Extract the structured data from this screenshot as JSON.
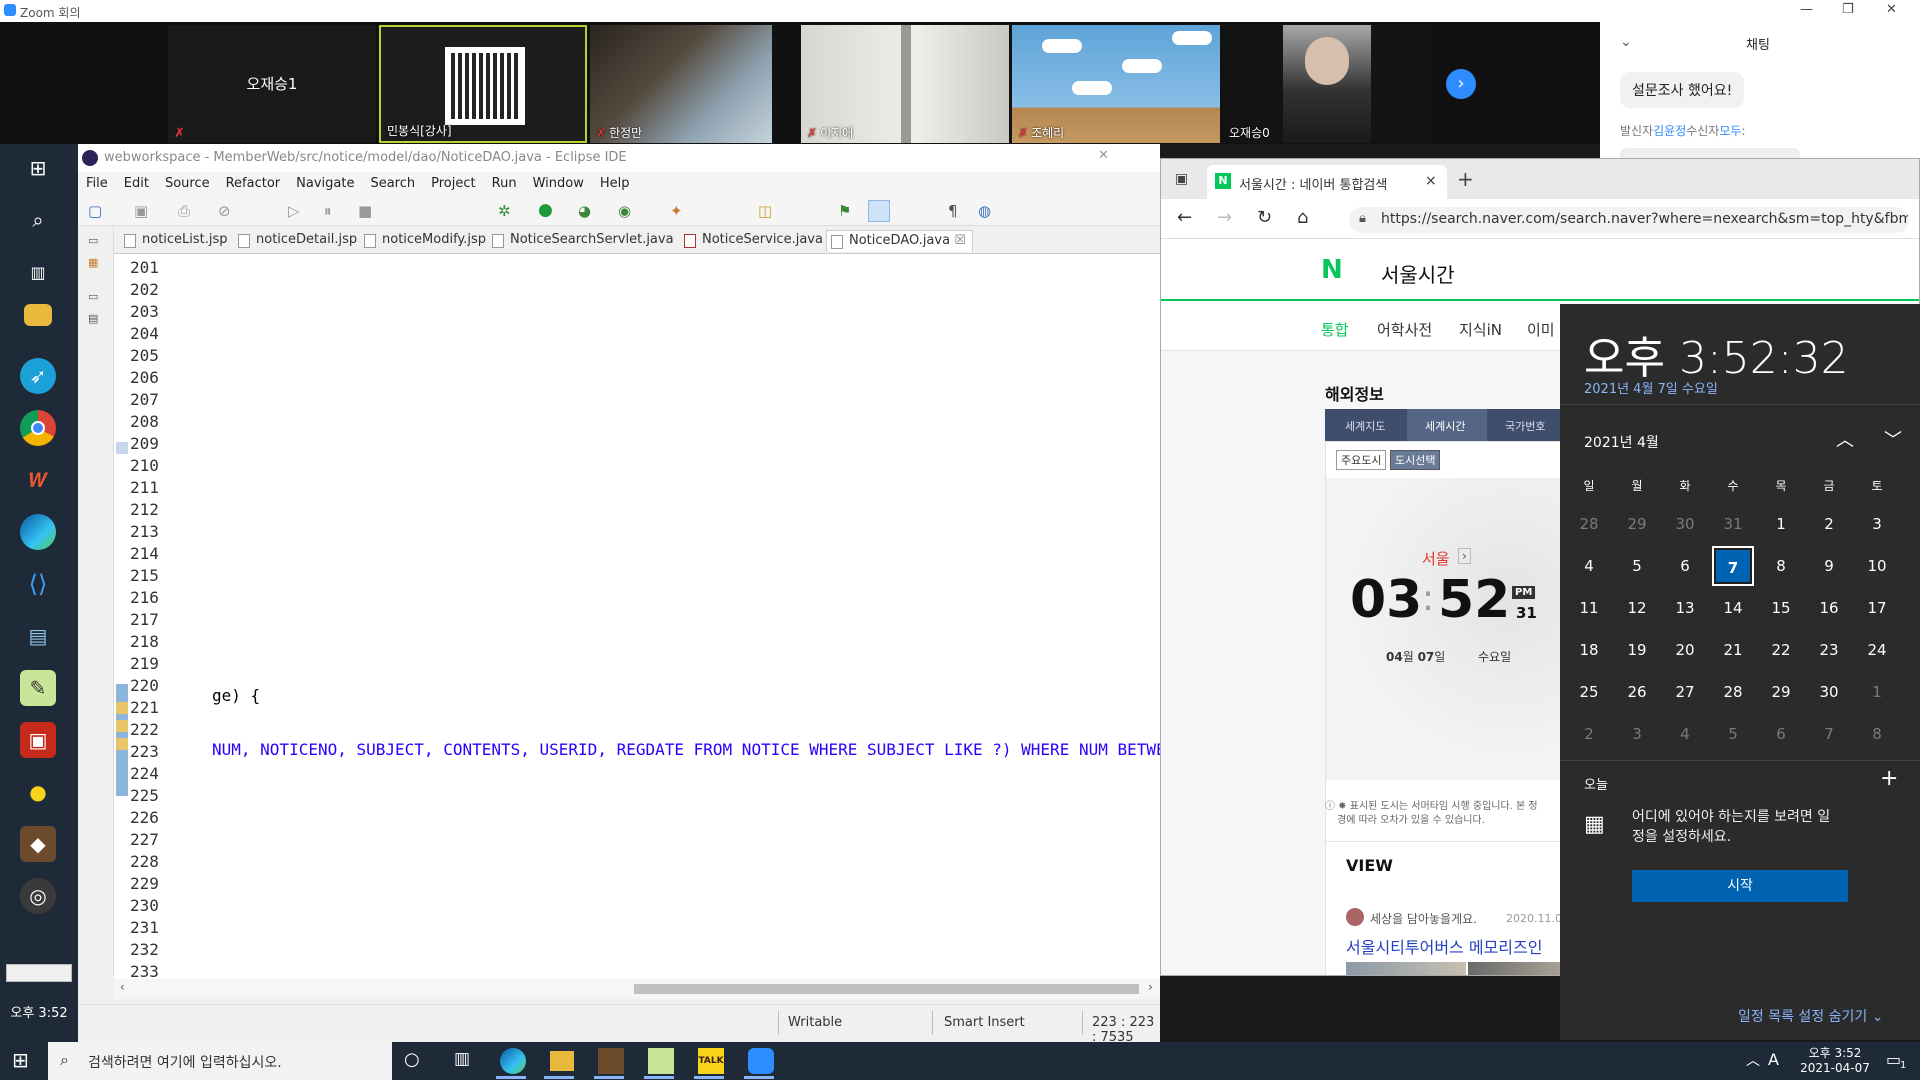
{
  "zoom": {
    "window_title": "Zoom 회의",
    "participants": [
      {
        "name": "오재승1"
      },
      {
        "name": "민봉식[강사]"
      },
      {
        "name": "한정만"
      },
      {
        "name": "이지애"
      },
      {
        "name": "조혜리"
      },
      {
        "name": "오재승0"
      }
    ],
    "chat": {
      "title": "채팅",
      "message": "설문조사 했어요!",
      "meta_prefix": "발신자",
      "sender": "김윤정",
      "meta_mid": "수신자",
      "recipient": "모두",
      "meta_suffix": ":"
    }
  },
  "left_taskbar": {
    "clock": "오후 3:52",
    "icons": [
      "windows-icon",
      "search-icon",
      "task-view-icon",
      "file-explorer-icon",
      "bird-app-icon",
      "chrome-icon",
      "app-icon",
      "edge-icon",
      "vscode-icon",
      "remote-desktop-icon",
      "notes-icon",
      "presentation-icon",
      "messenger-icon",
      "game-icon",
      "obs-icon"
    ]
  },
  "eclipse": {
    "title": "webworkspace - MemberWeb/src/notice/model/dao/NoticeDAO.java - Eclipse IDE",
    "menu": [
      "File",
      "Edit",
      "Source",
      "Refactor",
      "Navigate",
      "Search",
      "Project",
      "Run",
      "Window",
      "Help"
    ],
    "tabs": [
      {
        "label": "noticeList.jsp"
      },
      {
        "label": "noticeDetail.jsp"
      },
      {
        "label": "noticeModify.jsp"
      },
      {
        "label": "NoticeSearchServlet.java"
      },
      {
        "label": "NoticeService.java"
      },
      {
        "label": "NoticeDAO.java"
      }
    ],
    "tab_close": "☒",
    "line_numbers": [
      "201",
      "202",
      "203",
      "204",
      "205",
      "206",
      "207",
      "208",
      "209",
      "210",
      "211",
      "212",
      "213",
      "214",
      "215",
      "216",
      "217",
      "218",
      "219",
      "220",
      "221",
      "222",
      "223",
      "224",
      "225",
      "226",
      "227",
      "228",
      "229",
      "230",
      "231",
      "232",
      "233"
    ],
    "code_line_220": "ge) {",
    "code_line_223": "NUM, NOTICENO, SUBJECT, CONTENTS, USERID, REGDATE FROM NOTICE WHERE SUBJECT LIKE ?) WHERE NUM BETWEEN ? AN",
    "status": {
      "writable": "Writable",
      "insert_mode": "Smart Insert",
      "position": "223 : 223 : 7535"
    }
  },
  "browser": {
    "tab_title": "서울시간 : 네이버 통합검색",
    "tab_close": "×",
    "new_tab": "+",
    "url": "https://search.naver.com/search.naver?where=nexearch&sm=top_hty&fbm",
    "naver": {
      "logo": "N",
      "query": "서울시간",
      "nav": [
        "통합",
        "어학사전",
        "지식iN",
        "이미"
      ],
      "section_title": "해외정보",
      "info_tabs": [
        "세계지도",
        "세계시간",
        "국가번호"
      ],
      "sub_tabs": [
        "주요도시",
        "도시선택"
      ],
      "city": "서울",
      "hour": "03",
      "minute": "52",
      "ampm": "PM",
      "seconds": "31",
      "date_month": "04",
      "date_month_unit": "월",
      "date_day": "07",
      "date_day_unit": "일",
      "weekday": "수요일",
      "notice_line1": "표시된 도시는 서머타임 시행 중입니다. 본 정",
      "notice_line2": "경에 따라 오차가 있을 수 있습니다.",
      "view_title": "VIEW",
      "view_author": "세상을 담아놓을게요.",
      "view_date": "2020.11.0",
      "view_link": "서울시티투어버스 메모리즈인"
    }
  },
  "calendar": {
    "time_prefix": "오후",
    "time": "3:52:32",
    "date_full": "2021년 4월 7일 수요일",
    "month_label": "2021년 4월",
    "weekdays": [
      "일",
      "월",
      "화",
      "수",
      "목",
      "금",
      "토"
    ],
    "weeks": [
      [
        "28",
        "29",
        "30",
        "31",
        "1",
        "2",
        "3"
      ],
      [
        "4",
        "5",
        "6",
        "7",
        "8",
        "9",
        "10"
      ],
      [
        "11",
        "12",
        "13",
        "14",
        "15",
        "16",
        "17"
      ],
      [
        "18",
        "19",
        "20",
        "21",
        "22",
        "23",
        "24"
      ],
      [
        "25",
        "26",
        "27",
        "28",
        "29",
        "30",
        "1"
      ],
      [
        "2",
        "3",
        "4",
        "5",
        "6",
        "7",
        "8"
      ]
    ],
    "today_label": "오늘",
    "add_label": "+",
    "agenda_text_1": "어디에 있어야 하는지를 보려면 일",
    "agenda_text_2": "정을 설정하세요.",
    "start_button": "시작",
    "hide_agenda": "일정 목록 설정 숨기기"
  },
  "taskbar": {
    "search_placeholder": "검색하려면 여기에 입력하십시오.",
    "ime": "A",
    "time": "오후 3:52",
    "date": "2021-04-07",
    "notification_count": "1"
  }
}
